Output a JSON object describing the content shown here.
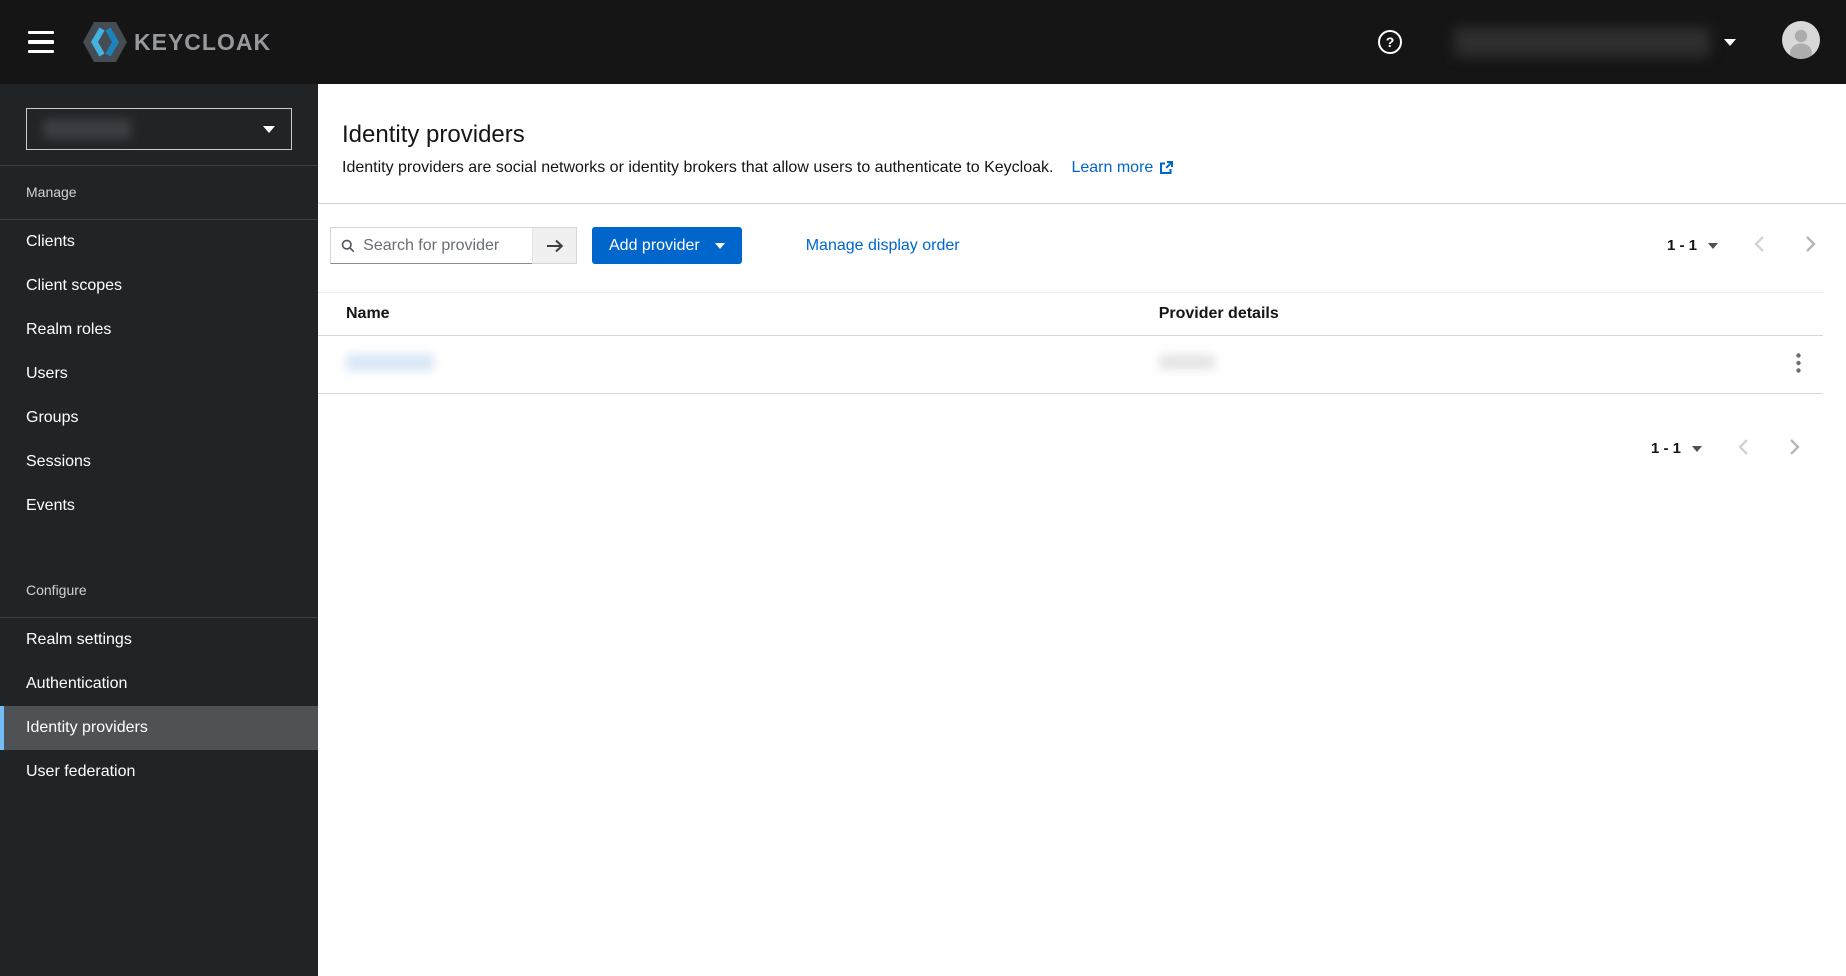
{
  "header": {
    "brand_text": "KEYCLOAK",
    "help_glyph": "?",
    "username_redacted": true
  },
  "sidebar": {
    "realm_selector": {
      "value_redacted": true
    },
    "sections": [
      {
        "label": "Manage",
        "items": [
          "Clients",
          "Client scopes",
          "Realm roles",
          "Users",
          "Groups",
          "Sessions",
          "Events"
        ]
      },
      {
        "label": "Configure",
        "items": [
          "Realm settings",
          "Authentication",
          "Identity providers",
          "User federation"
        ],
        "selected_item": "Identity providers"
      }
    ]
  },
  "page": {
    "title": "Identity providers",
    "description": "Identity providers are social networks or identity brokers that allow users to authenticate to Keycloak.",
    "learn_more_label": "Learn more"
  },
  "toolbar": {
    "search_placeholder": "Search for provider",
    "add_provider_label": "Add provider",
    "manage_display_order_label": "Manage display order",
    "pagination_range": "1 - 1"
  },
  "table": {
    "columns": [
      "Name",
      "Provider details"
    ],
    "rows": [
      {
        "name_redacted": true,
        "details_redacted": true
      }
    ]
  },
  "pagination_bottom": {
    "range": "1 - 1"
  },
  "colors": {
    "primary_blue": "#0066cc",
    "link_blue": "#0066cc",
    "masthead_bg": "#151515",
    "sidebar_bg": "#212427",
    "nav_selected_bg": "#4f5255",
    "nav_selected_indicator": "#73bcf7"
  }
}
